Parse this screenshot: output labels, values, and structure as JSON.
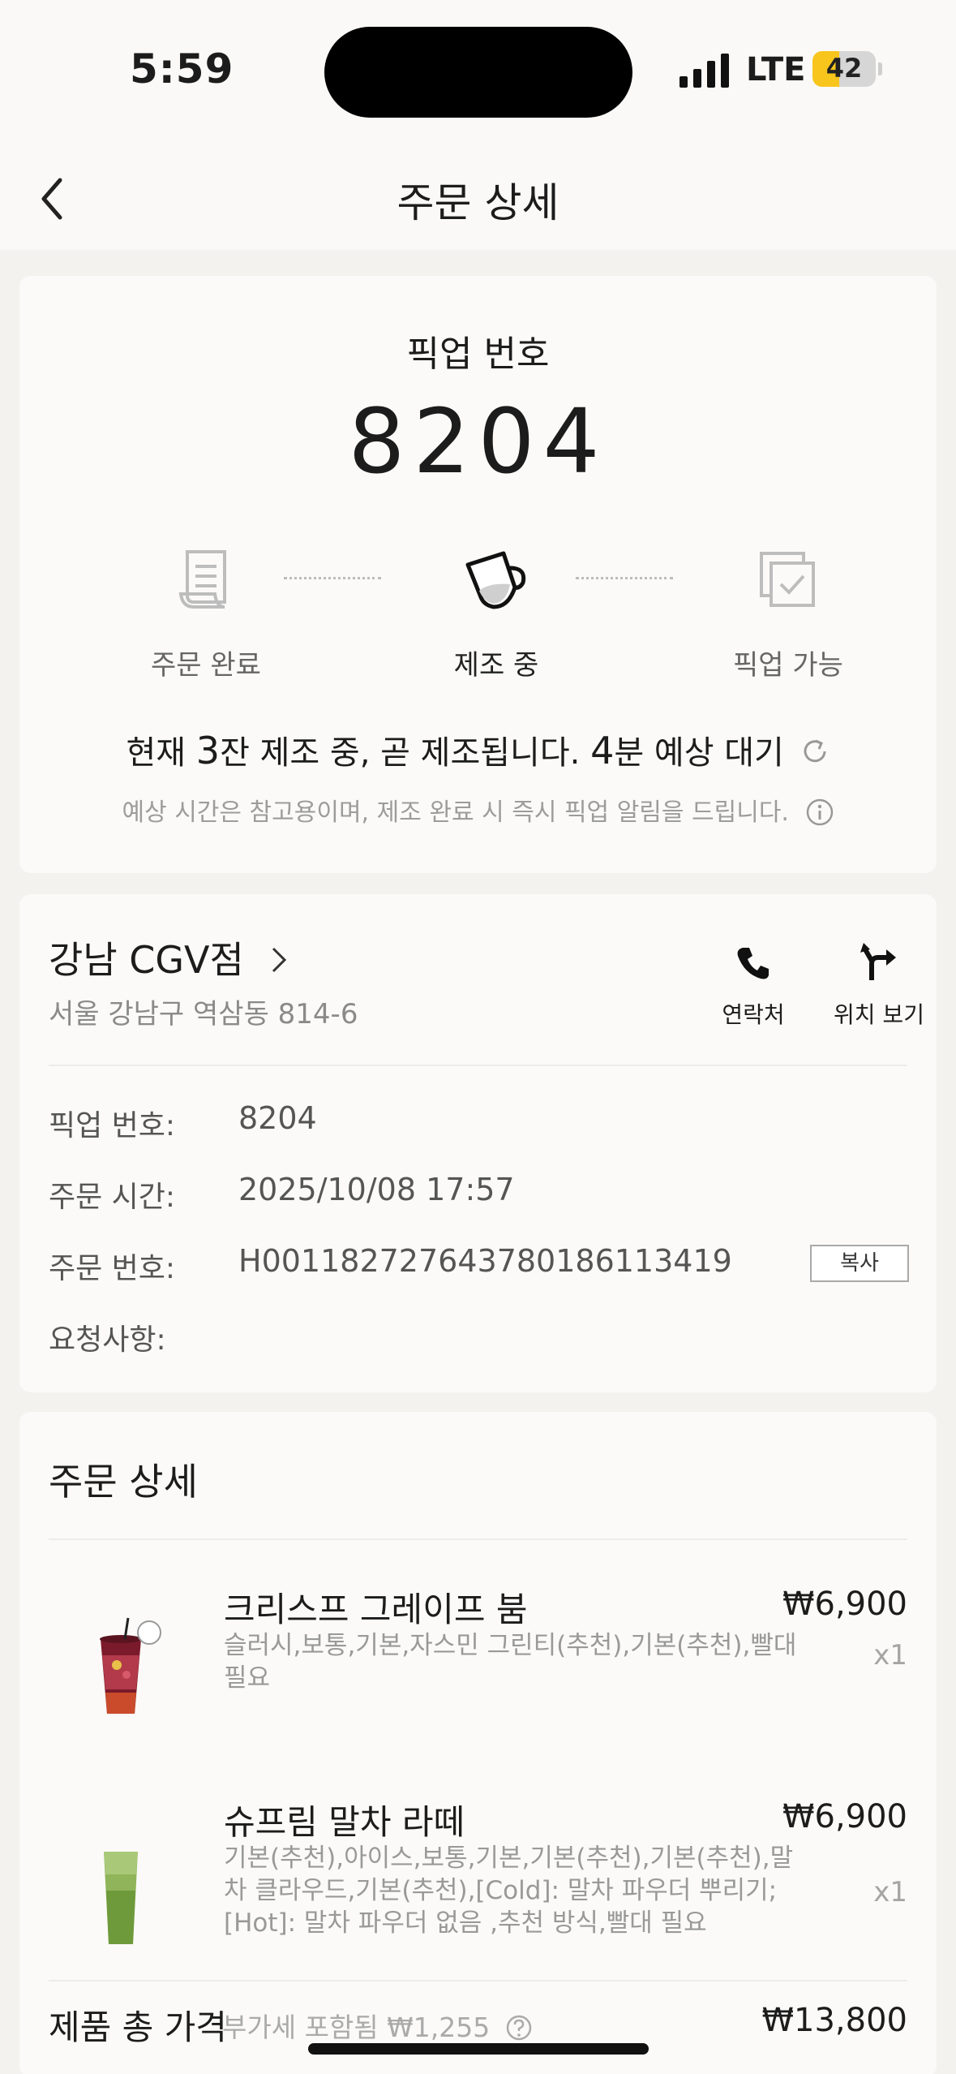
{
  "status": {
    "time": "5:59",
    "network": "LTE",
    "battery": "42",
    "battery_level": 0.42
  },
  "nav": {
    "title": "주문 상세"
  },
  "pickup": {
    "label": "픽업 번호",
    "number": "8204",
    "steps": [
      "주문 완료",
      "제조 중",
      "픽업 가능"
    ],
    "active_step": 1,
    "wait": {
      "p1": "현재 ",
      "cups": "3",
      "p2": "잔 제조 중, 곧 제조됩니다. ",
      "minutes": "4",
      "p3": "분 예상 대기"
    },
    "note": "예상 시간은 참고용이며, 제조 완료 시 즉시 픽업 알림을 드립니다."
  },
  "store": {
    "name": "강남 CGV점",
    "address": "서울 강남구 역삼동 814-6",
    "contact_label": "연락처",
    "location_label": "위치 보기"
  },
  "info": {
    "pickup_label": "픽업 번호:",
    "pickup_value": "8204",
    "time_label": "주문 시간:",
    "time_value": "2025/10/08 17:57",
    "order_label": "주문 번호:",
    "order_value": "H00118272764378018611341​9",
    "copy_label": "복사",
    "request_label": "요청사항:"
  },
  "order": {
    "title": "주문 상세",
    "items": [
      {
        "name": "크리스프 그레이프 붐",
        "options": "슬러시,보통,기본,자스민 그린티(추천),기본(추천),빨대 필요",
        "price": "₩6,900",
        "qty": "x1"
      },
      {
        "name": "슈프림 말차 라떼",
        "options": "기본(추천),아이스,보통,기본,기본(추천),기본(추천),말차 클라우드,기본(추천),[Cold]: 말차 파우더 뿌리기;[Hot]: 말차 파우더 없음 ,추천 방식,빨대 필요",
        "price": "₩6,900",
        "qty": "x1"
      }
    ],
    "total_label": "제품 총 가격",
    "vat": "부가세 포함됨 ₩1,255",
    "total": "₩13,800"
  }
}
